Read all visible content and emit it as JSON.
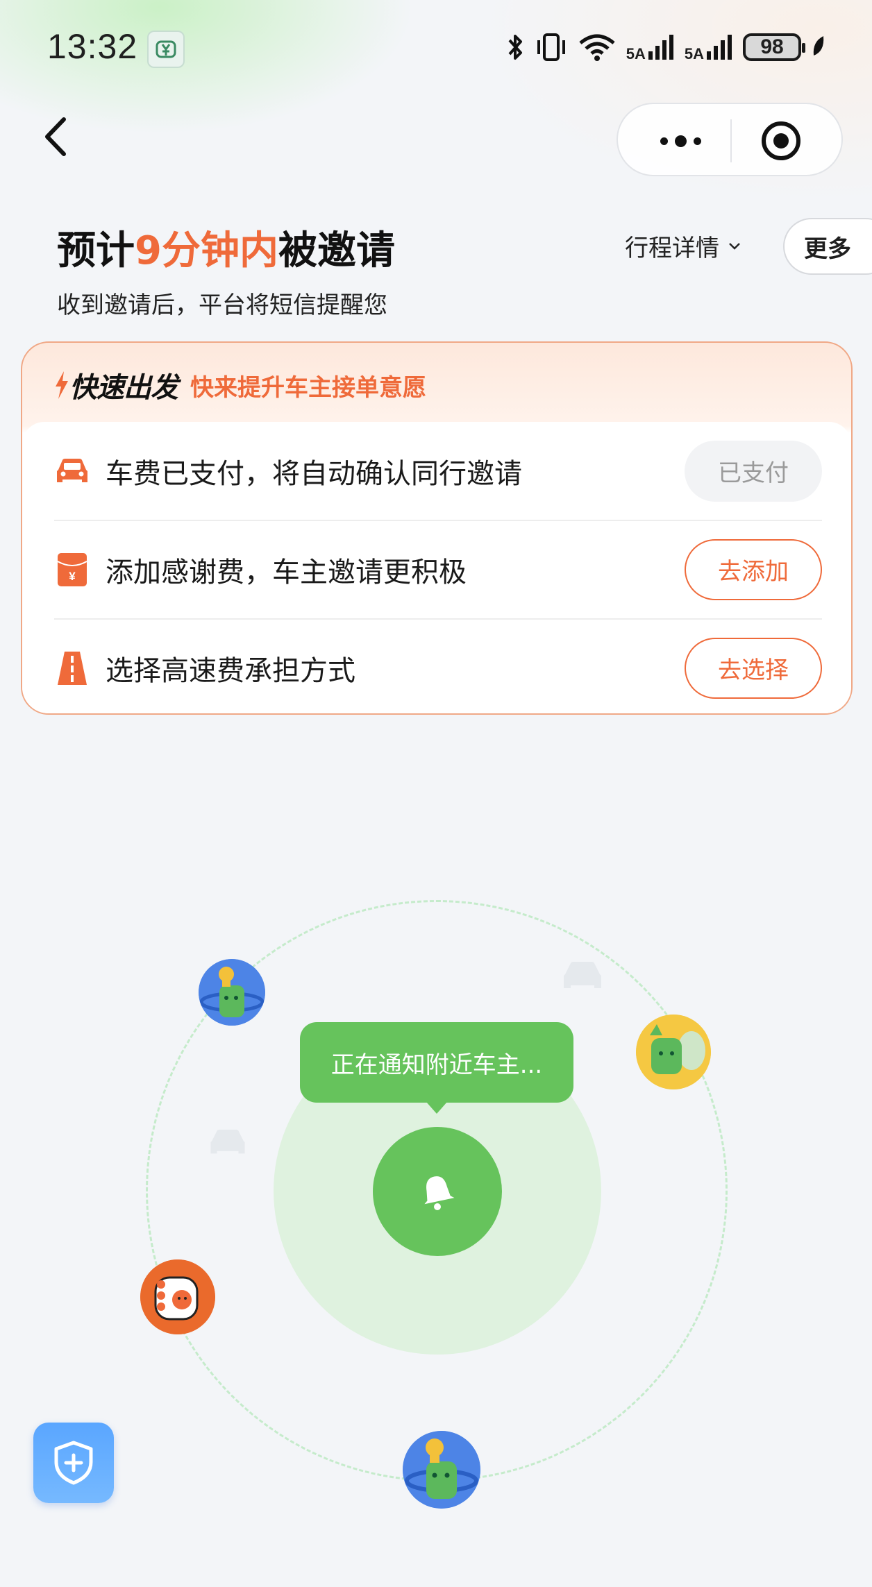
{
  "status_bar": {
    "time": "13:32",
    "network_1": "5A",
    "network_2": "5A",
    "battery": "98"
  },
  "header": {
    "title_prefix": "预计",
    "title_highlight": "9分钟内",
    "title_suffix": "被邀请",
    "subtitle": "收到邀请后，平台将短信提醒您",
    "trip_details": "行程详情",
    "more": "更多"
  },
  "card": {
    "brand_title": "快速出发",
    "slogan": "快来提升车主接单意愿",
    "rows": [
      {
        "icon": "car-icon",
        "text": "车费已支付，将自动确认同行邀请",
        "button": "已支付"
      },
      {
        "icon": "red-envelope-icon",
        "text": "添加感谢费，车主邀请更积极",
        "button": "去添加"
      },
      {
        "icon": "highway-icon",
        "text": "选择高速费承担方式",
        "button": "去选择"
      }
    ]
  },
  "radar": {
    "tooltip": "正在通知附近车主..."
  },
  "colors": {
    "accent": "#ef6a3a",
    "green": "#66c35c",
    "safety_blue": "#5aa6ff"
  }
}
